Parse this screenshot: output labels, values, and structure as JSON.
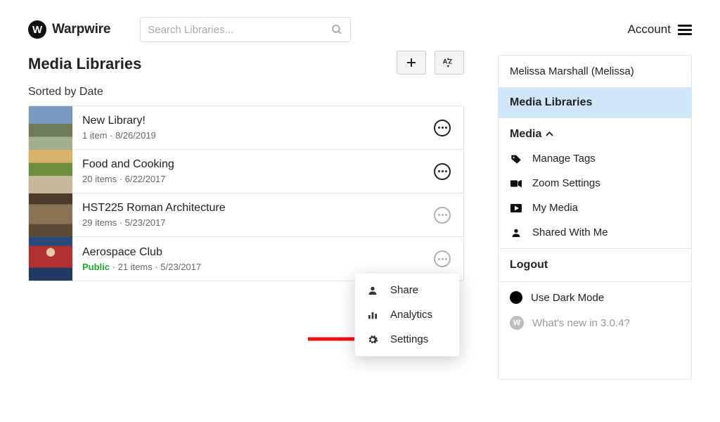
{
  "brand": {
    "name": "Warpwire",
    "mark": "W"
  },
  "search": {
    "placeholder": "Search Libraries..."
  },
  "account": {
    "label": "Account"
  },
  "page": {
    "title": "Media Libraries",
    "sorted_by": "Sorted by Date"
  },
  "libraries": [
    {
      "title": "New Library!",
      "meta": "1 item · 8/26/2019",
      "public": false
    },
    {
      "title": "Food and Cooking",
      "meta": "20 items · 6/22/2017",
      "public": false
    },
    {
      "title": "HST225 Roman Architecture",
      "meta": "29 items · 5/23/2017",
      "public": false
    },
    {
      "title": "Aerospace Club",
      "meta": "21 items · 5/23/2017",
      "public": true,
      "public_label": "Public"
    }
  ],
  "popover": {
    "share": "Share",
    "analytics": "Analytics",
    "settings": "Settings"
  },
  "sidebar": {
    "user": "Melissa Marshall (Melissa)",
    "active": "Media Libraries",
    "media_head": "Media",
    "items": {
      "manage_tags": "Manage Tags",
      "zoom_settings": "Zoom Settings",
      "my_media": "My Media",
      "shared": "Shared With Me"
    },
    "logout": "Logout",
    "dark_mode": "Use Dark Mode",
    "whats_new": "What's new in 3.0.4?"
  }
}
